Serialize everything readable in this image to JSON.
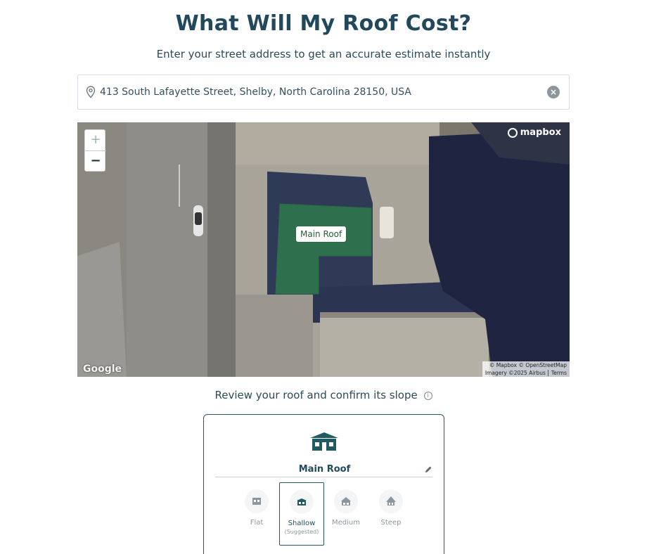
{
  "header": {
    "title": "What Will My Roof Cost?",
    "subtitle": "Enter your street address to get an accurate estimate instantly"
  },
  "search": {
    "value": "413 South Lafayette Street, Shelby, North Carolina 28150, USA",
    "pin_icon": "map-pin-icon",
    "clear_icon": "clear-icon"
  },
  "map": {
    "zoom_in": "+",
    "zoom_out": "−",
    "mapbox_logo": "mapbox",
    "google_logo": "Google",
    "attribution_line1": "© Mapbox © OpenStreetMap",
    "attribution_imagery": "Imagery ©2025 Airbus",
    "attribution_terms": "Terms",
    "roof_label": "Main Roof",
    "roof_color": "#2e7a4c"
  },
  "review": {
    "text": "Review your roof and confirm its slope",
    "info_icon": "info-icon"
  },
  "roof_card": {
    "name": "Main Roof",
    "house_icon": "house-icon",
    "edit_icon": "pencil-icon",
    "accent_color": "#1f5b60",
    "slopes": [
      {
        "label": "Flat",
        "icon": "flat-roof-icon",
        "selected": false
      },
      {
        "label": "Shallow",
        "icon": "shallow-roof-icon",
        "selected": true,
        "note": "(Suggested)"
      },
      {
        "label": "Medium",
        "icon": "medium-roof-icon",
        "selected": false
      },
      {
        "label": "Steep",
        "icon": "steep-roof-icon",
        "selected": false
      }
    ]
  }
}
